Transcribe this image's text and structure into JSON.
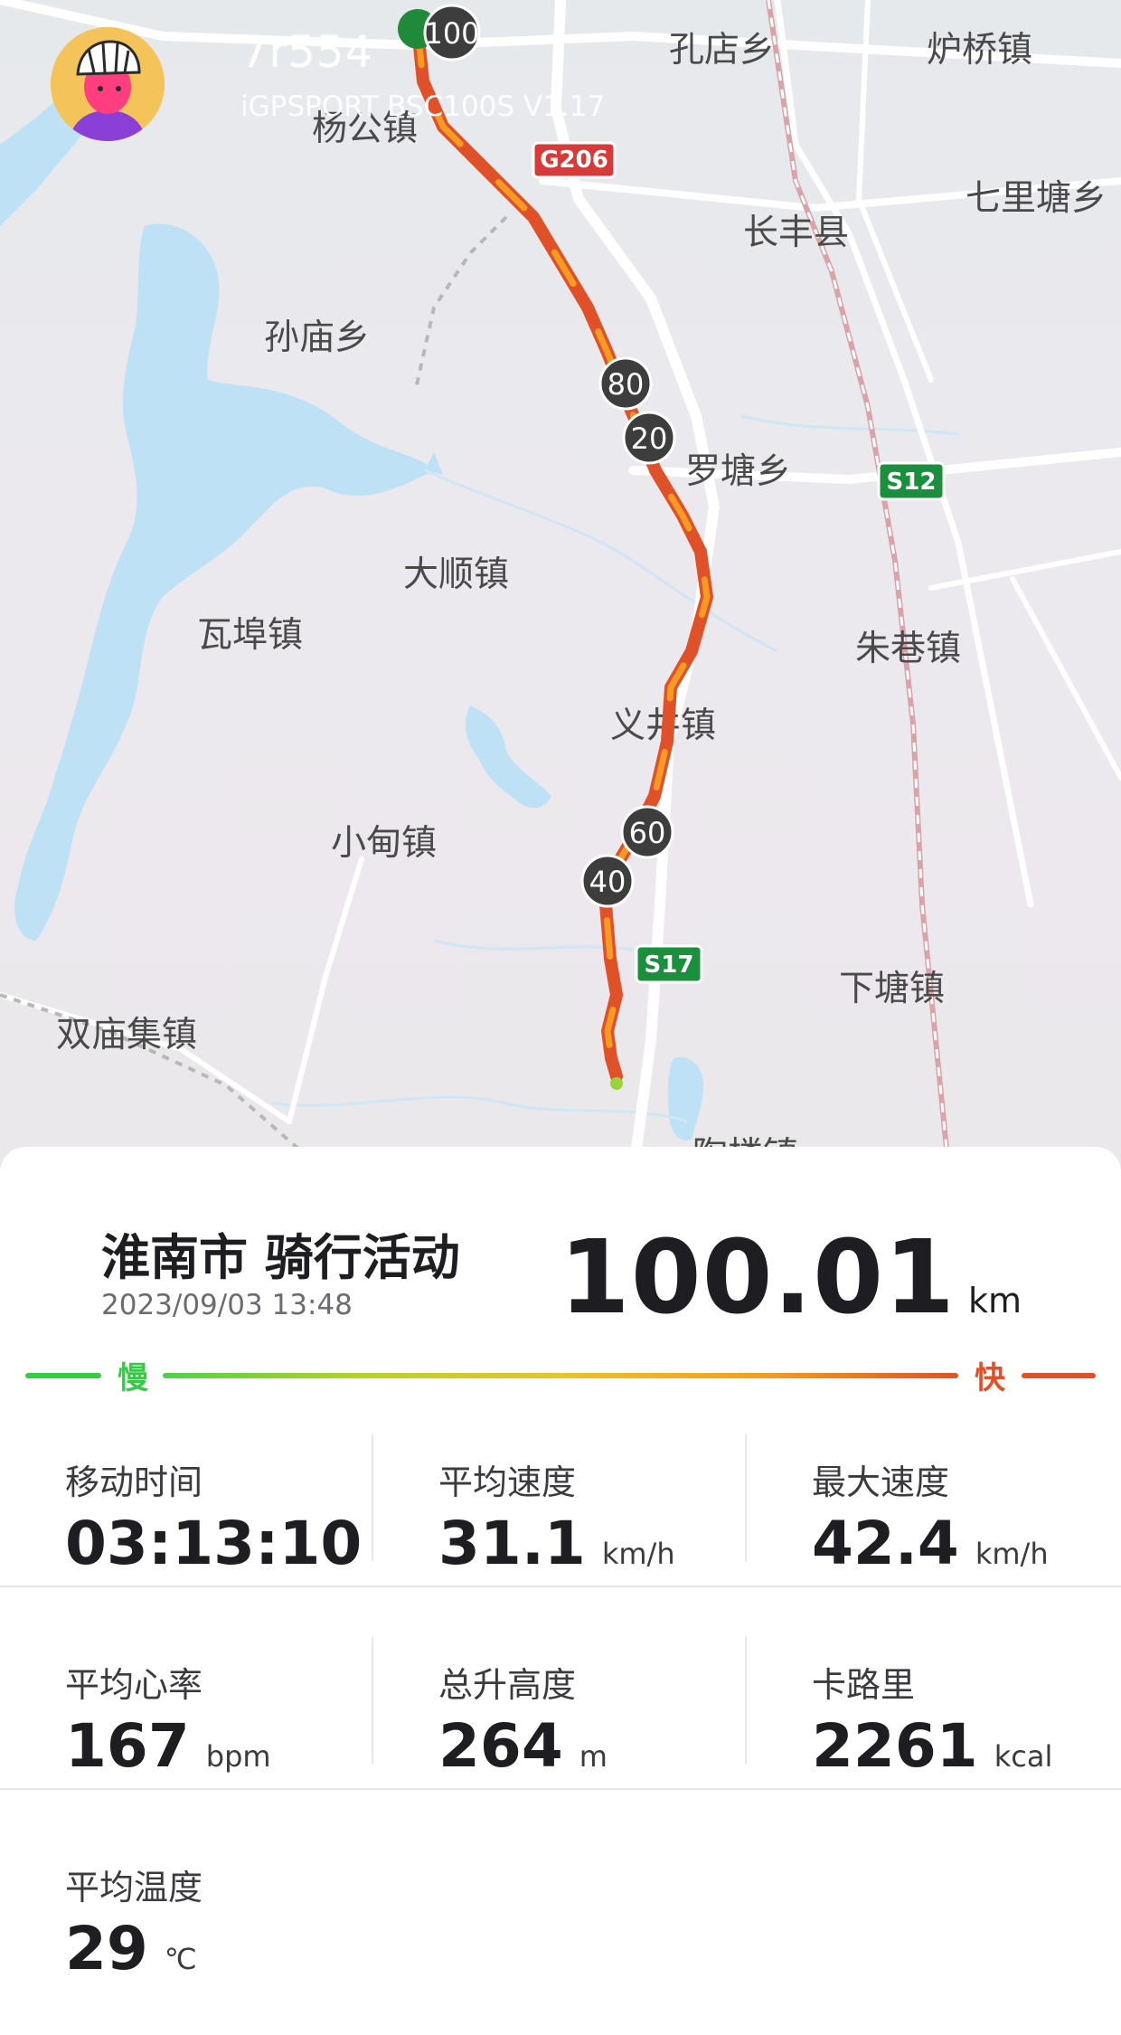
{
  "header": {
    "user_name": "7r554",
    "device": "iGPSPORT BSC100S  V1.17"
  },
  "map": {
    "place_labels": [
      "孔店乡",
      "炉桥镇",
      "杨公镇",
      "长丰县",
      "七里塘乡",
      "孙庙乡",
      "罗塘乡",
      "大顺镇",
      "瓦埠镇",
      "朱巷镇",
      "义井镇",
      "小甸镇",
      "下塘镇",
      "双庙集镇",
      "陶楼镇"
    ],
    "road_shields": [
      "G206",
      "S12",
      "S17"
    ],
    "km_markers": [
      "100",
      "80",
      "20",
      "60",
      "40"
    ]
  },
  "activity": {
    "title": "淮南市 骑行活动",
    "date": "2023/09/03 13:48",
    "distance": "100.01",
    "distance_unit": "km"
  },
  "legend": {
    "slow": "慢",
    "fast": "快"
  },
  "stats": [
    {
      "label": "移动时间",
      "value": "03:13:10",
      "unit": ""
    },
    {
      "label": "平均速度",
      "value": "31.1",
      "unit": "km/h"
    },
    {
      "label": "最大速度",
      "value": "42.4",
      "unit": "km/h"
    },
    {
      "label": "平均心率",
      "value": "167",
      "unit": "bpm"
    },
    {
      "label": "总升高度",
      "value": "264",
      "unit": "m"
    },
    {
      "label": "卡路里",
      "value": "2261",
      "unit": "kcal"
    },
    {
      "label": "平均温度",
      "value": "29",
      "unit": "℃"
    }
  ],
  "colors": {
    "slow": "#33cc44",
    "fast": "#e0512a",
    "route": "#f08a1c",
    "water": "#bfe1f6",
    "highway_shield": "#1b8f3e",
    "national_road_shield": "#d83a3a"
  }
}
